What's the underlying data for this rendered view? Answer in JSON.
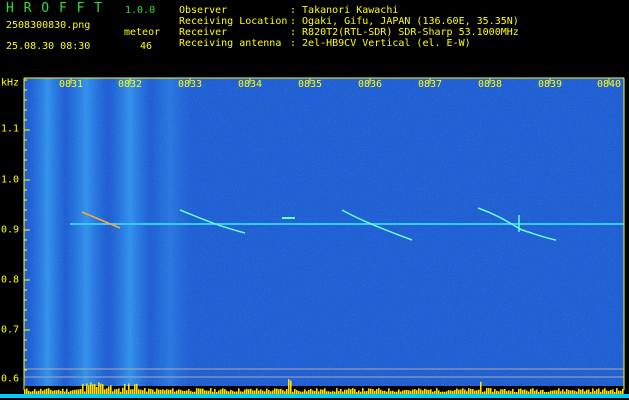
{
  "logo": {
    "text": "H R O F F T",
    "version": "1.0.0"
  },
  "file": {
    "name": "2508300830.png",
    "datetime": "25.08.30 08:30"
  },
  "meteor": {
    "label": "meteor",
    "count": "46"
  },
  "info": {
    "labels": [
      "Observer",
      "Receiving Location",
      "Receiver",
      "Receiving antenna"
    ],
    "values": [
      ": Takanori Kawachi",
      ": Ogaki, Gifu, JAPAN (136.60E, 35.35N)",
      ": R820T2(RTL-SDR) SDR-Sharp 53.1000MHz",
      ": 2el-HB9CV Vertical (el. E-W)"
    ]
  },
  "axis": {
    "y_unit": "kHz",
    "y_ticks": [
      "1.1",
      "1.0",
      "0.9",
      "0.8",
      "0.7",
      "0.6"
    ],
    "x_ticks": [
      "0831",
      "0832",
      "0833",
      "0834",
      "0835",
      "0836",
      "0837",
      "0838",
      "0839",
      "0840"
    ]
  },
  "colors": {
    "text_yellow": "#ffff00",
    "text_green": "#33dd33",
    "background_noise": "#001a66",
    "carrier": "#33ccff",
    "level_bar": "#ffdd00",
    "baseline": "#00ccff"
  }
}
